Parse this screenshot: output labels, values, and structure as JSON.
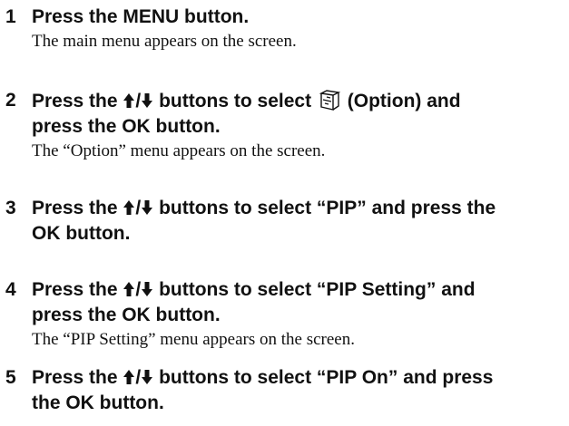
{
  "steps": [
    {
      "number": "1",
      "title_line1": "Press the MENU button.",
      "description": "The main menu appears on the screen."
    },
    {
      "number": "2",
      "title_line1_pre": "Press the ",
      "arrow_sep": "/",
      "title_line1_mid": " buttons to select ",
      "title_line1_post": " (Option) and",
      "title_line2": "press the OK button.",
      "description": "The “Option” menu appears on the screen."
    },
    {
      "number": "3",
      "title_line1_pre": "Press the ",
      "arrow_sep": "/",
      "title_line1_post": " buttons to select “PIP” and press the",
      "title_line2": "OK button."
    },
    {
      "number": "4",
      "title_line1_pre": "Press the ",
      "arrow_sep": "/",
      "title_line1_post": " buttons to select “PIP Setting” and",
      "title_line2": "press the OK button.",
      "description": "The “PIP Setting” menu appears on the screen."
    },
    {
      "number": "5",
      "title_line1_pre": "Press the ",
      "arrow_sep": "/",
      "title_line1_post": " buttons to select “PIP On” and press",
      "title_line2": "the OK button."
    }
  ],
  "icons": {
    "up": "up-arrow-icon",
    "down": "down-arrow-icon",
    "option": "option-toolbox-icon"
  }
}
